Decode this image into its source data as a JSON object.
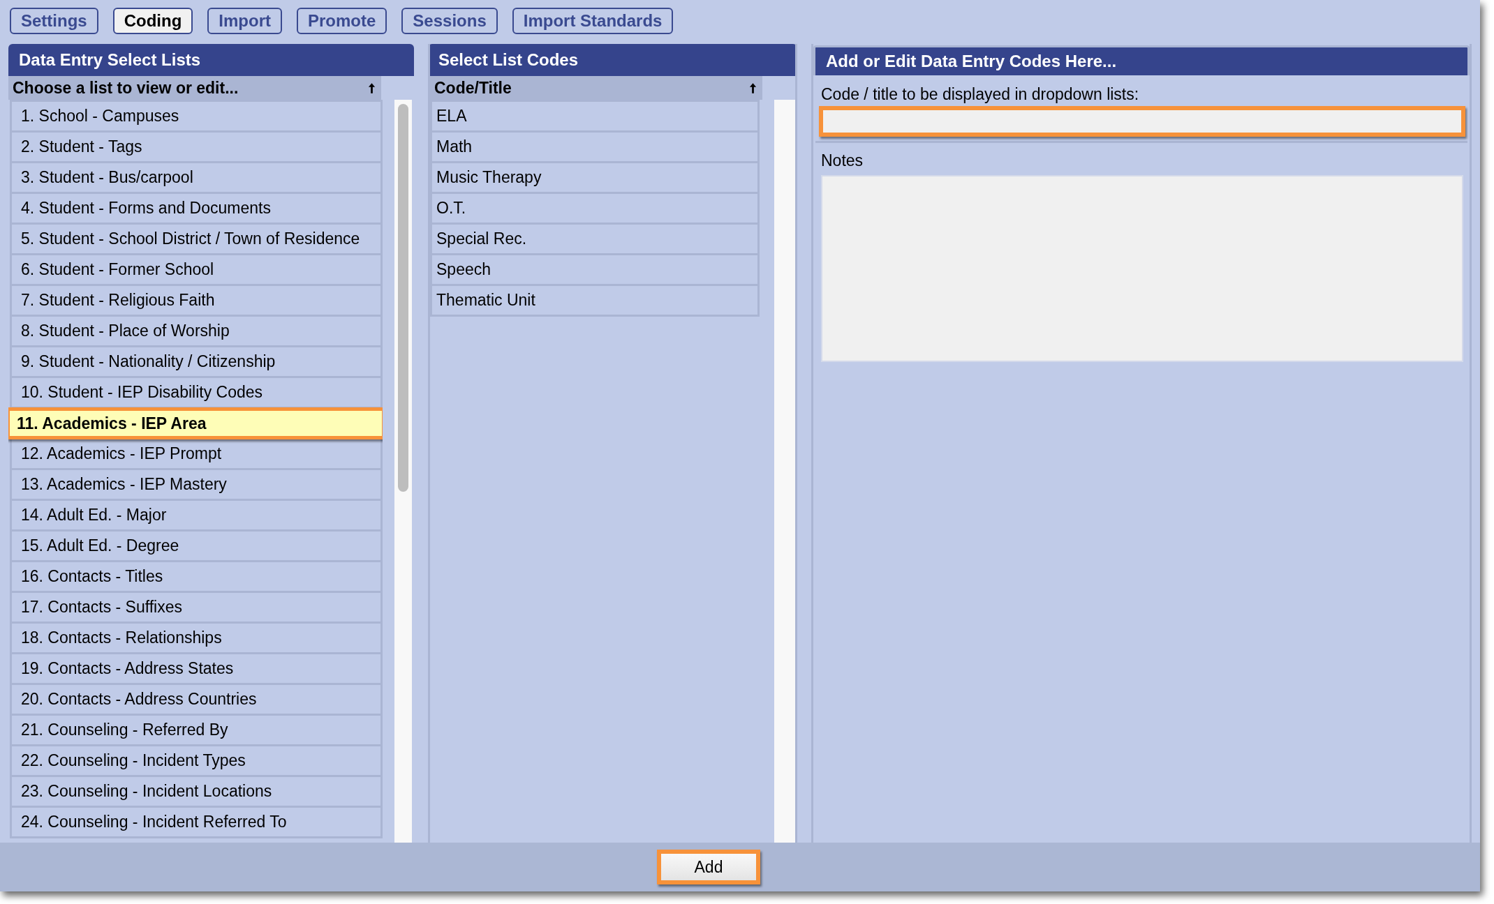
{
  "tabs": [
    {
      "label": "Settings",
      "selected": false
    },
    {
      "label": "Coding",
      "selected": true
    },
    {
      "label": "Import",
      "selected": false
    },
    {
      "label": "Promote",
      "selected": false
    },
    {
      "label": "Sessions",
      "selected": false
    },
    {
      "label": "Import Standards",
      "selected": false
    }
  ],
  "lists_panel": {
    "title": "Data Entry Select Lists",
    "column": "Choose a list to view or edit...",
    "items": [
      {
        "label": "1. School - Campuses",
        "selected": false,
        "highlighted": false
      },
      {
        "label": "2. Student - Tags",
        "selected": false,
        "highlighted": false
      },
      {
        "label": "3. Student - Bus/carpool",
        "selected": false,
        "highlighted": false
      },
      {
        "label": "4. Student - Forms and Documents",
        "selected": false,
        "highlighted": false
      },
      {
        "label": "5. Student - School District / Town of Residence",
        "selected": false,
        "highlighted": false
      },
      {
        "label": "6. Student - Former School",
        "selected": false,
        "highlighted": false
      },
      {
        "label": "7. Student - Religious Faith",
        "selected": false,
        "highlighted": false
      },
      {
        "label": "8. Student - Place of Worship",
        "selected": false,
        "highlighted": false
      },
      {
        "label": "9. Student - Nationality / Citizenship",
        "selected": false,
        "highlighted": false
      },
      {
        "label": "10. Student - IEP Disability Codes",
        "selected": false,
        "highlighted": false
      },
      {
        "label": "11. Academics - IEP Area",
        "selected": true,
        "highlighted": true
      },
      {
        "label": "12. Academics - IEP Prompt",
        "selected": false,
        "highlighted": false
      },
      {
        "label": "13. Academics - IEP Mastery",
        "selected": false,
        "highlighted": false
      },
      {
        "label": "14. Adult Ed. - Major",
        "selected": false,
        "highlighted": false
      },
      {
        "label": "15. Adult Ed. - Degree",
        "selected": false,
        "highlighted": false
      },
      {
        "label": "16. Contacts - Titles",
        "selected": false,
        "highlighted": false
      },
      {
        "label": "17. Contacts - Suffixes",
        "selected": false,
        "highlighted": false
      },
      {
        "label": "18. Contacts - Relationships",
        "selected": false,
        "highlighted": false
      },
      {
        "label": "19. Contacts - Address States",
        "selected": false,
        "highlighted": false
      },
      {
        "label": "20. Contacts - Address Countries",
        "selected": false,
        "highlighted": false
      },
      {
        "label": "21. Counseling - Referred By",
        "selected": false,
        "highlighted": false
      },
      {
        "label": "22. Counseling - Incident Types",
        "selected": false,
        "highlighted": false
      },
      {
        "label": "23. Counseling - Incident Locations",
        "selected": false,
        "highlighted": false
      },
      {
        "label": "24. Counseling - Incident Referred To",
        "selected": false,
        "highlighted": false
      }
    ]
  },
  "codes_panel": {
    "title": "Select List Codes",
    "column": "Code/Title",
    "items": [
      "ELA",
      "Math",
      "Music Therapy",
      "O.T.",
      "Special Rec.",
      "Speech",
      "Thematic Unit"
    ]
  },
  "edit_panel": {
    "title": "Add or Edit Data Entry Codes Here...",
    "code_label": "Code / title to be displayed in dropdown lists:",
    "code_field_highlighted": true,
    "notes_label": "Notes"
  },
  "add_button": {
    "label": "Add",
    "highlighted": true
  }
}
